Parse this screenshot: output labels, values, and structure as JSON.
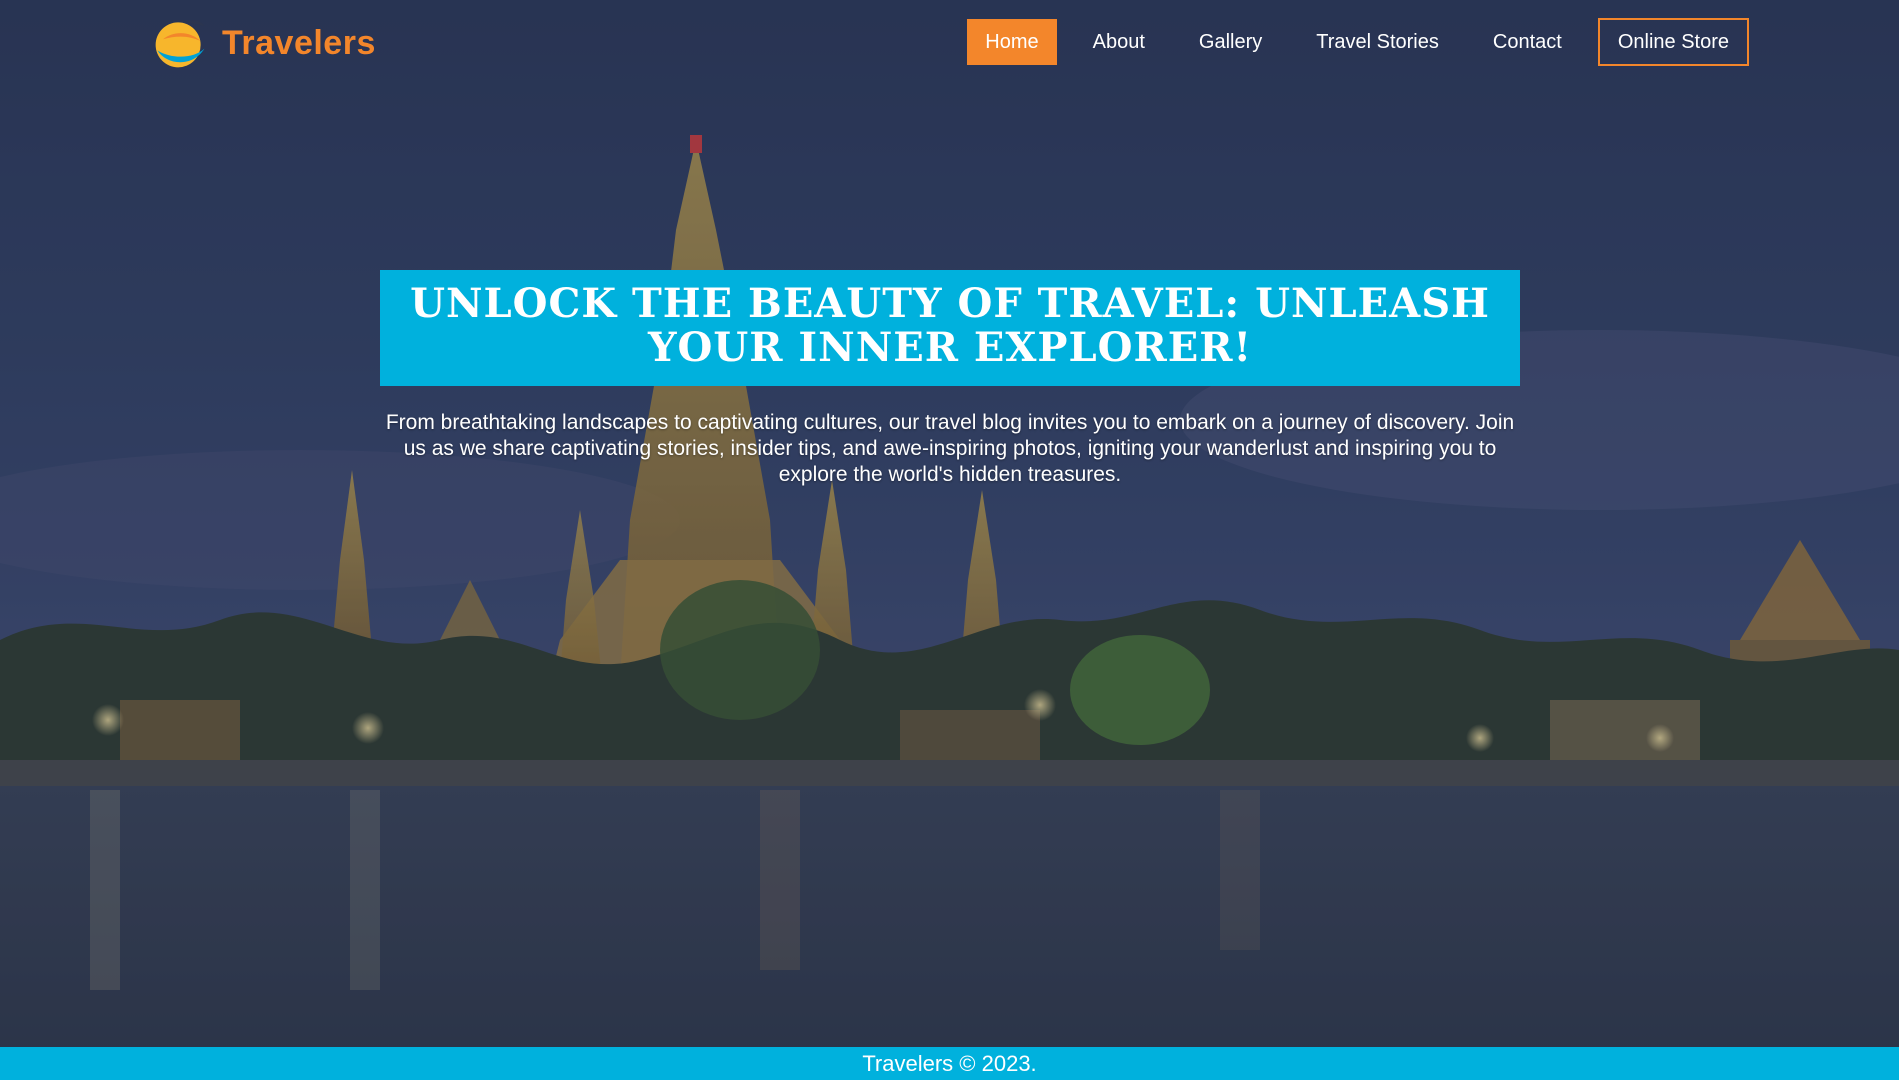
{
  "brand": {
    "name": "Travelers",
    "logo_icon": "travel-bird-logo-icon",
    "color": "#f3862b"
  },
  "nav": {
    "items": [
      {
        "label": "Home",
        "active": true
      },
      {
        "label": "About",
        "active": false
      },
      {
        "label": "Gallery",
        "active": false
      },
      {
        "label": "Travel Stories",
        "active": false
      },
      {
        "label": "Contact",
        "active": false
      }
    ],
    "store_label": "Online Store",
    "accent_color": "#f3862b"
  },
  "hero": {
    "title": "Unlock the Beauty of Travel: Unleash Your Inner Explorer!",
    "text": "From breathtaking landscapes to captivating cultures, our travel blog invites you to embark on a journey of discovery. Join us as we share captivating stories, insider tips, and awe-inspiring photos, igniting your wanderlust and inspiring you to explore the world's hidden treasures.",
    "title_bg_color": "#00b1dd"
  },
  "footer": {
    "text": "Travelers © 2023.",
    "bg_color": "#00b1dd"
  }
}
